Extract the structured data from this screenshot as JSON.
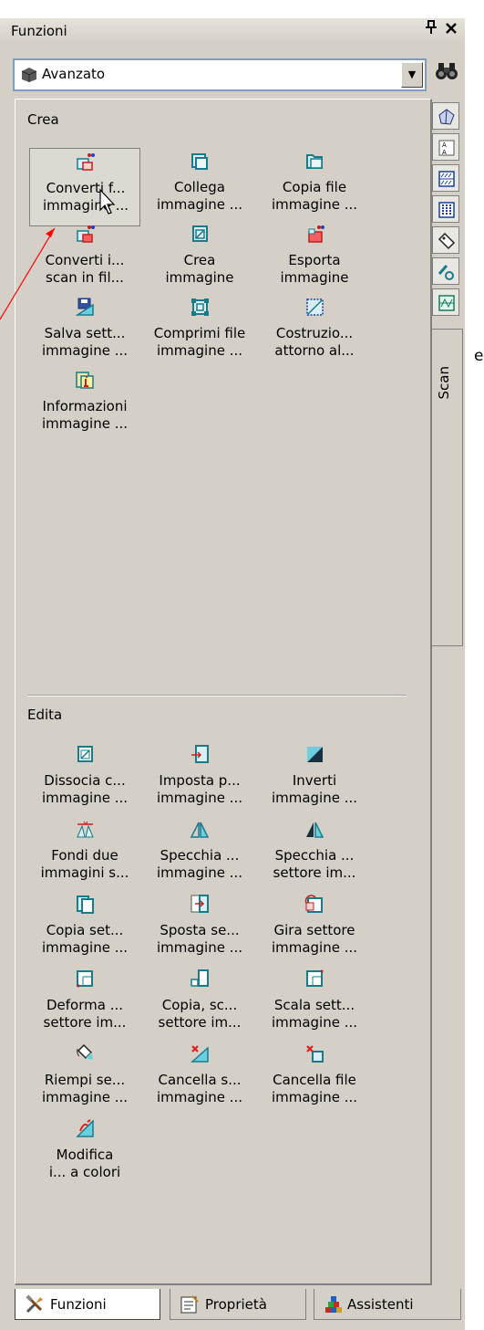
{
  "window": {
    "title": "Funzioni",
    "pin_icon": "pin-icon",
    "close_icon": "close-icon"
  },
  "combo": {
    "value": "Avanzato",
    "icon": "cube-icon"
  },
  "crea": {
    "title": "Crea",
    "items": [
      {
        "l1": "Converti f...",
        "l2": "immagine ...",
        "icon": "convert-image-icon"
      },
      {
        "l1": "Collega",
        "l2": "immagine ...",
        "icon": "link-image-icon"
      },
      {
        "l1": "Copia file",
        "l2": "immagine ...",
        "icon": "copy-file-icon"
      },
      {
        "l1": "Converti i...",
        "l2": "scan in fil...",
        "icon": "convert-scan-icon"
      },
      {
        "l1": "Crea",
        "l2": "immagine",
        "icon": "create-image-icon"
      },
      {
        "l1": "Esporta",
        "l2": "immagine",
        "icon": "export-image-icon"
      },
      {
        "l1": "Salva sett...",
        "l2": "immagine ...",
        "icon": "save-sector-icon"
      },
      {
        "l1": "Comprimi file",
        "l2": "immagine ...",
        "icon": "compress-file-icon"
      },
      {
        "l1": "Costruzio...",
        "l2": "attorno al...",
        "icon": "construction-icon"
      },
      {
        "l1": "Informazioni",
        "l2": "immagine ...",
        "icon": "info-image-icon"
      }
    ]
  },
  "edita": {
    "title": "Edita",
    "items": [
      {
        "l1": "Dissocia c...",
        "l2": "immagine ...",
        "icon": "dissociate-icon"
      },
      {
        "l1": "Imposta p...",
        "l2": "immagine ...",
        "icon": "set-point-icon"
      },
      {
        "l1": "Inverti",
        "l2": "immagine ...",
        "icon": "invert-icon"
      },
      {
        "l1": "Fondi due",
        "l2": "immagini s...",
        "icon": "merge-icon"
      },
      {
        "l1": "Specchia ...",
        "l2": "immagine ...",
        "icon": "mirror-icon"
      },
      {
        "l1": "Specchia ...",
        "l2": "settore im...",
        "icon": "mirror-sector-icon"
      },
      {
        "l1": "Copia set...",
        "l2": "immagine ...",
        "icon": "copy-sector-icon"
      },
      {
        "l1": "Sposta se...",
        "l2": "immagine ...",
        "icon": "move-sector-icon"
      },
      {
        "l1": "Gira settore",
        "l2": "immagine ...",
        "icon": "rotate-sector-icon"
      },
      {
        "l1": "Deforma ...",
        "l2": "settore im...",
        "icon": "deform-icon"
      },
      {
        "l1": "Copia, sc...",
        "l2": "settore im...",
        "icon": "copy-scale-icon"
      },
      {
        "l1": "Scala sett...",
        "l2": "immagine ...",
        "icon": "scale-sector-icon"
      },
      {
        "l1": "Riempi se...",
        "l2": "immagine ...",
        "icon": "fill-sector-icon"
      },
      {
        "l1": "Cancella s...",
        "l2": "immagine ...",
        "icon": "delete-sector-icon"
      },
      {
        "l1": "Cancella file",
        "l2": "immagine ...",
        "icon": "delete-file-icon"
      },
      {
        "l1": "Modifica",
        "l2": "i... a colori",
        "icon": "modify-colors-icon"
      }
    ]
  },
  "side_tabs": {
    "active_label": "Scan"
  },
  "annotation": {
    "text": "e",
    "color": "#ff0000"
  },
  "bottom_tabs": [
    {
      "label": "Funzioni",
      "icon": "tools-icon"
    },
    {
      "label": "Proprietà",
      "icon": "properties-icon"
    },
    {
      "label": "Assistenti",
      "icon": "assistants-icon"
    }
  ]
}
